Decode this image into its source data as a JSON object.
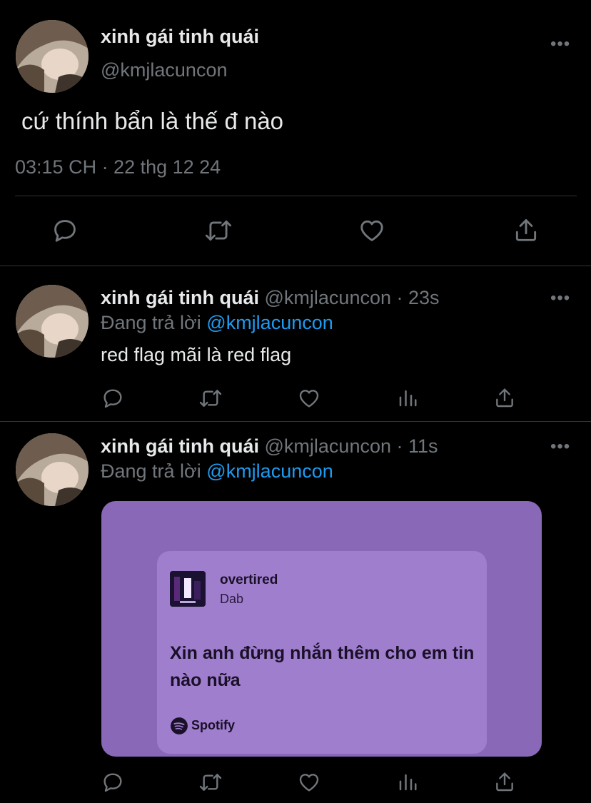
{
  "main_tweet": {
    "display_name": "xinh gái tinh quái",
    "handle": "@kmjlacuncon",
    "text": "cứ thính bẩn là thế đ nào",
    "timestamp": "03:15 CH · 22 thg 12 24"
  },
  "replies": [
    {
      "display_name": "xinh gái tinh quái",
      "meta": "@kmjlacuncon · 23s",
      "replying_prefix": "Đang trả lời",
      "replying_to": "@kmjlacuncon",
      "text": "red flag mãi là red flag"
    },
    {
      "display_name": "xinh gái tinh quái",
      "meta": "@kmjlacuncon · 11s",
      "replying_prefix": "Đang trả lời",
      "replying_to": "@kmjlacuncon",
      "card": {
        "song_title": "overtired",
        "artist": "Dab",
        "lyric": "Xin anh đừng nhắn thêm cho em tin nào nữa",
        "brand": "Spotify"
      }
    }
  ],
  "colors": {
    "background": "#000000",
    "text": "#e7e9ea",
    "secondary": "#71767b",
    "link": "#1d9bf0",
    "card_outer": "#8a68b8",
    "card_inner": "#a07fce"
  }
}
